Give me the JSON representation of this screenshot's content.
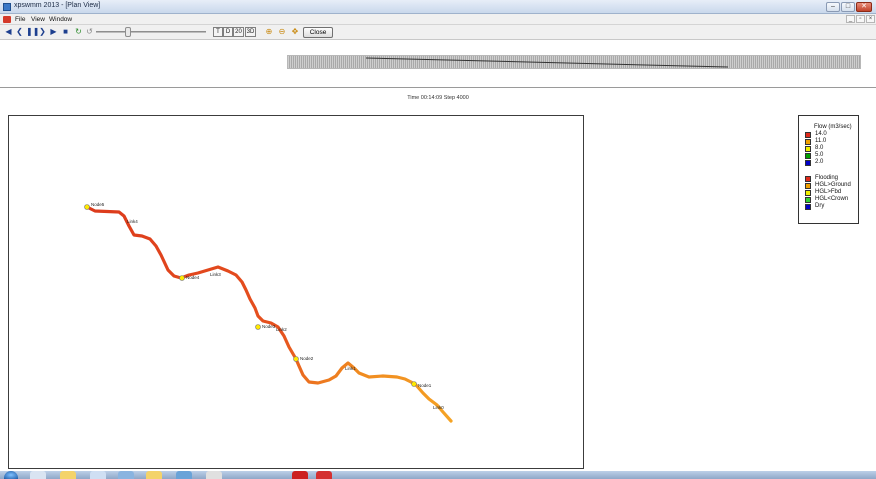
{
  "window": {
    "title": "xpswmm 2013 - [Plan View]",
    "controls": [
      "–",
      "□",
      "✕"
    ]
  },
  "menubar": {
    "items": [
      "File",
      "View",
      "Window"
    ],
    "mdi_controls": [
      "_",
      "▫",
      "×"
    ]
  },
  "toolbar": {
    "playback_icons": [
      "◀",
      "❮",
      "❚❚",
      "❯",
      "▶",
      "■",
      "↻",
      "↺"
    ],
    "segment_buttons": [
      "T",
      "D",
      "20",
      "3D"
    ],
    "nav_icons": [
      "⊕",
      "⊖",
      "✥"
    ],
    "close_label": "Close"
  },
  "status": {
    "time_step": "Time 00:14:09 Step 4000"
  },
  "map": {
    "pipe_color_upstream": "#e0401e",
    "pipe_color_downstream": "#f39a22",
    "node_color": "#ffe800",
    "node_labels": [
      "Node5",
      "Link4",
      "Node4",
      "Link3",
      "Node3",
      "Link2",
      "Node2",
      "Link1",
      "Node1",
      "Link0"
    ]
  },
  "legend": {
    "title": "Flow (m3/sec)",
    "flow_entries": [
      {
        "color": "#e02a1a",
        "label": "14.0"
      },
      {
        "color": "#f0a000",
        "label": "11.0"
      },
      {
        "color": "#f0f000",
        "label": "8.0"
      },
      {
        "color": "#00a000",
        "label": "5.0"
      },
      {
        "color": "#0000c8",
        "label": "2.0"
      }
    ],
    "status_entries": [
      {
        "color": "#e02a1a",
        "label": "Flooding"
      },
      {
        "color": "#f0a000",
        "label": "HGL>Ground"
      },
      {
        "color": "#f0f000",
        "label": "HGL>Fbd"
      },
      {
        "color": "#30d030",
        "label": "HGL<Crown"
      },
      {
        "color": "#0000c8",
        "label": "Dry"
      }
    ]
  },
  "taskbar": {
    "item_colors": [
      "#d9e4f2",
      "#f4d36a",
      "#cfdff3",
      "#8ab4e0",
      "#f4d36a",
      "#6aa3d8",
      "#e0e0e0",
      "#cc2020",
      "#d43030"
    ]
  }
}
